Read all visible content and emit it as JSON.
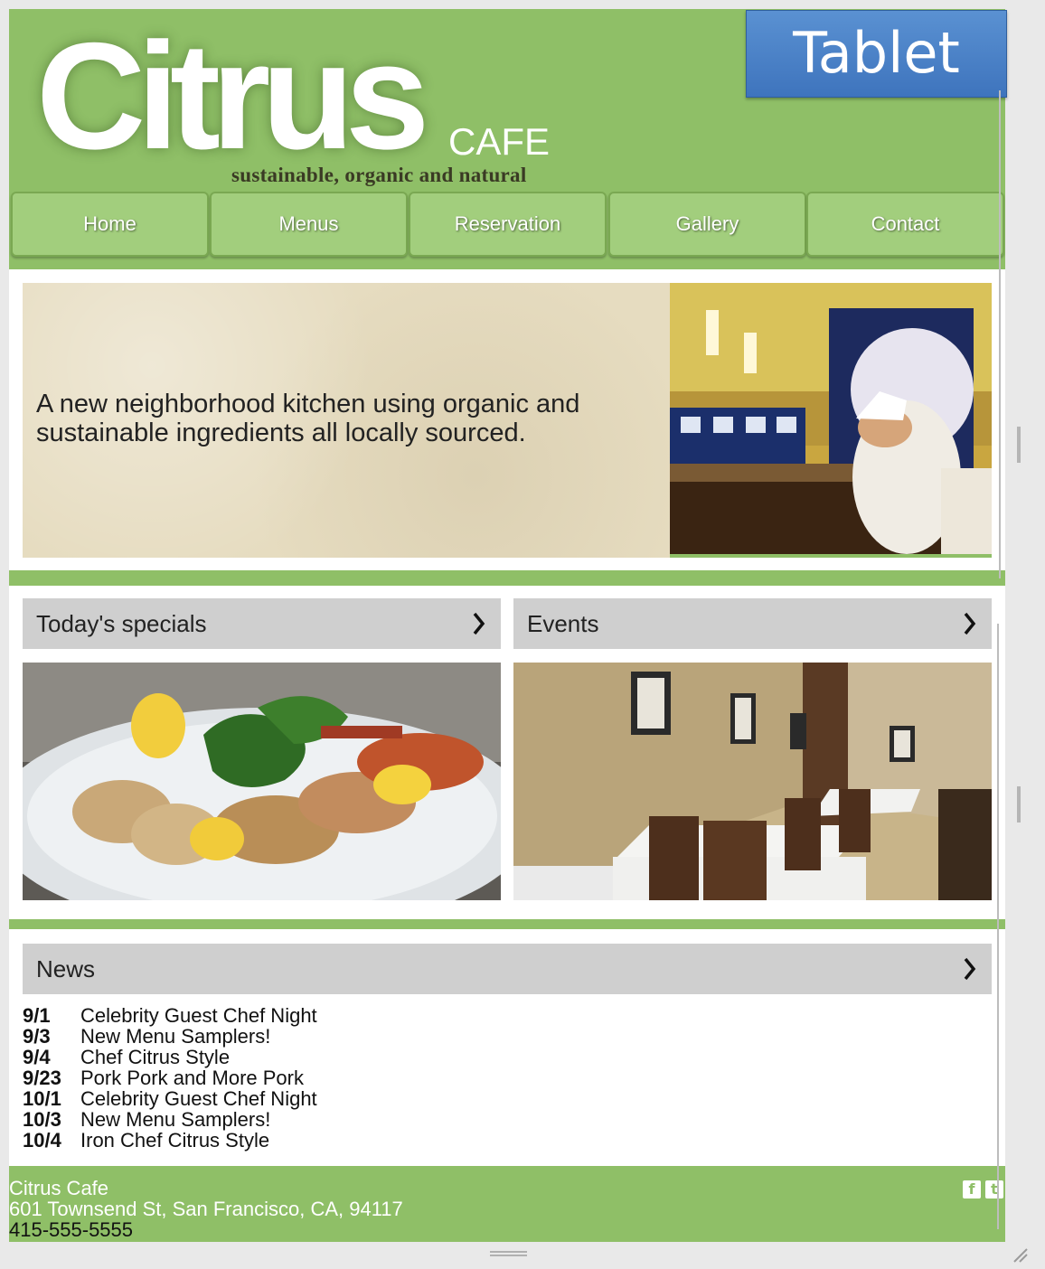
{
  "badge": {
    "label": "Tablet"
  },
  "brand": {
    "name": "Citrus",
    "suffix": "CAFE",
    "tagline": "sustainable, organic and natural"
  },
  "nav": {
    "items": [
      "Home",
      "Menus",
      "Reservation",
      "Gallery",
      "Contact"
    ]
  },
  "hero": {
    "text": "A new neighborhood kitchen using organic and sustainable ingredients all locally sourced."
  },
  "panels": {
    "specials": {
      "title": "Today's specials"
    },
    "events": {
      "title": "Events"
    },
    "news": {
      "title": "News"
    }
  },
  "news_items": [
    {
      "date": "9/1",
      "title": "Celebrity Guest Chef Night"
    },
    {
      "date": "9/3",
      "title": "New Menu Samplers!"
    },
    {
      "date": "9/4",
      "title": "Chef Citrus Style"
    },
    {
      "date": "9/23",
      "title": "Pork Pork and More Pork"
    },
    {
      "date": "10/1",
      "title": "Celebrity Guest Chef Night"
    },
    {
      "date": "10/3",
      "title": "New Menu Samplers!"
    },
    {
      "date": "10/4",
      "title": "Iron Chef Citrus Style"
    }
  ],
  "footer": {
    "name": "Citrus Cafe",
    "address": "601 Townsend St, San Francisco, CA, 94117",
    "phone": "415-555-5555"
  },
  "icons": [
    "chevron-right-icon",
    "facebook-icon",
    "twitter-icon",
    "resize-handle-icon"
  ],
  "colors": {
    "brand_green": "#8fbf67",
    "nav_green": "#a2ce7d",
    "badge_blue": "#4a80c8",
    "panel_gray": "#cfcfcf"
  }
}
